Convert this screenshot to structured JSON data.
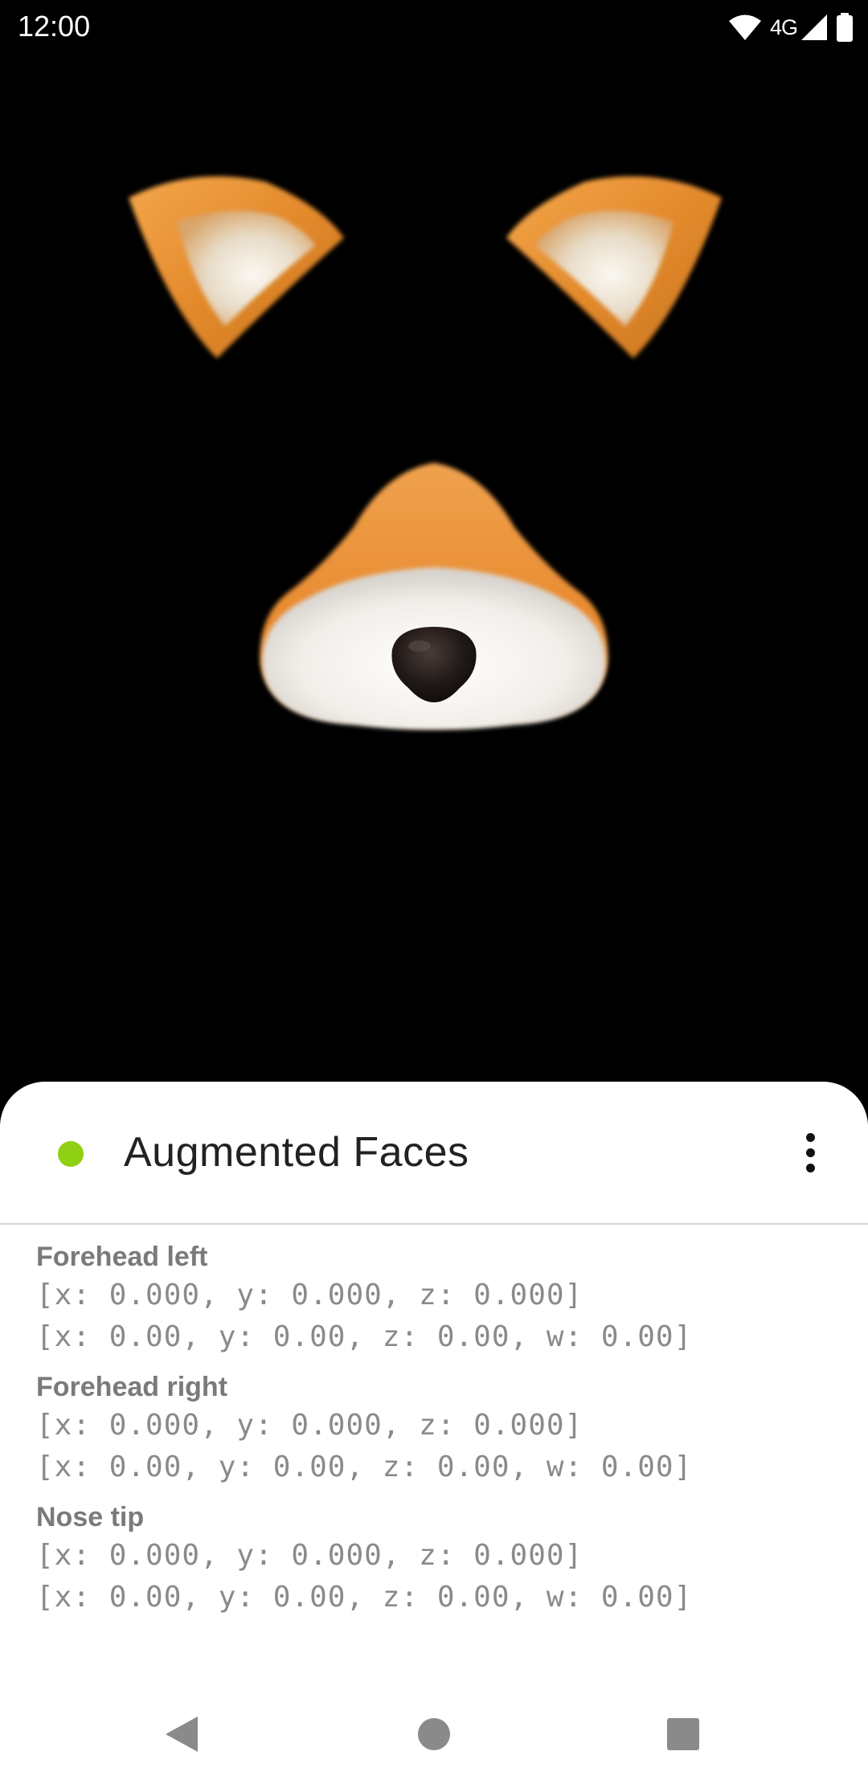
{
  "status_bar": {
    "time": "12:00",
    "network": "4G",
    "icons": [
      "wifi-icon",
      "cell-signal-icon",
      "battery-icon"
    ]
  },
  "app": {
    "title": "Augmented Faces",
    "status_color": "#8fcf14",
    "menu_icon": "more-vert-icon"
  },
  "landmarks": [
    {
      "name": "Forehead left",
      "position": "[x: 0.000, y: 0.000, z: 0.000]",
      "rotation": "[x: 0.00, y: 0.00, z: 0.00, w: 0.00]"
    },
    {
      "name": "Forehead right",
      "position": "[x: 0.000, y: 0.000, z: 0.000]",
      "rotation": "[x: 0.00, y: 0.00, z: 0.00, w: 0.00]"
    },
    {
      "name": "Nose tip",
      "position": "[x: 0.000, y: 0.000, z: 0.000]",
      "rotation": "[x: 0.00, y: 0.00, z: 0.00, w: 0.00]"
    }
  ],
  "nav_bar": {
    "back_icon": "back-triangle-icon",
    "home_icon": "home-circle-icon",
    "recents_icon": "recents-square-icon"
  },
  "colors": {
    "fur_orange": "#e8892e",
    "fur_white": "#f4f1ec",
    "nose": "#1c1614",
    "sheet_bg": "#ffffff"
  }
}
